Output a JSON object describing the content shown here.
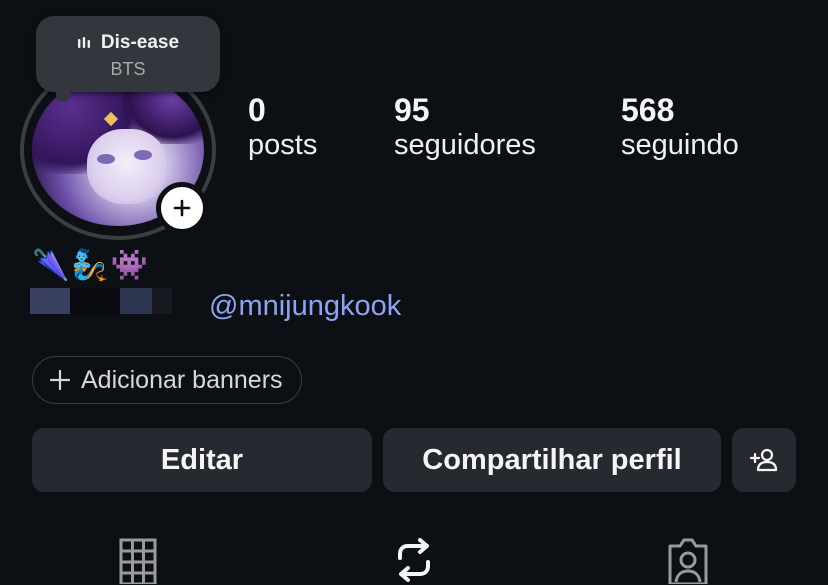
{
  "note": {
    "song_title": "Dis-ease",
    "artist": "BTS",
    "icon": "audio-bars-icon"
  },
  "stats": {
    "posts": {
      "value": "0",
      "label": "posts"
    },
    "followers": {
      "value": "95",
      "label": "seguidores"
    },
    "following": {
      "value": "568",
      "label": "seguindo"
    }
  },
  "profile": {
    "emojis": "🌂🧞👾",
    "handle": "@mnijungkook",
    "add_story_icon": "plus-icon"
  },
  "banner": {
    "label": "Adicionar banners",
    "icon": "plus-icon"
  },
  "actions": {
    "edit_label": "Editar",
    "share_label": "Compartilhar perfil",
    "suggest_icon": "add-person-icon"
  },
  "tabs": [
    {
      "name": "grid",
      "icon": "grid-icon"
    },
    {
      "name": "reposts",
      "icon": "repost-icon"
    },
    {
      "name": "tagged",
      "icon": "tagged-person-icon"
    }
  ],
  "colors": {
    "background": "#0c1014",
    "button": "#262a30",
    "link": "#8fa3f5"
  }
}
